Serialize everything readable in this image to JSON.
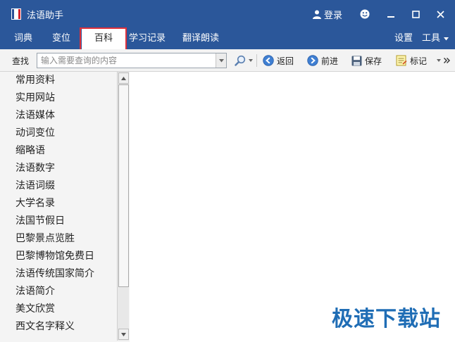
{
  "app": {
    "title": "法语助手"
  },
  "titlebar": {
    "login_label": "登录"
  },
  "menu": {
    "tabs": [
      {
        "label": "词典"
      },
      {
        "label": "变位"
      },
      {
        "label": "百科"
      },
      {
        "label": "学习记录"
      },
      {
        "label": "翻译朗读"
      }
    ],
    "active_tab": "百科",
    "settings_label": "设置",
    "tools_label": "工具"
  },
  "toolbar": {
    "search_label": "查找",
    "search_placeholder": "输入需要查询的内容",
    "search_value": "",
    "back_label": "返回",
    "forward_label": "前进",
    "save_label": "保存",
    "bookmark_label": "标记"
  },
  "sidebar": {
    "items": [
      "常用资料",
      "实用网站",
      "法语媒体",
      "动词变位",
      "缩略语",
      "法语数字",
      "法语词缀",
      "大学名录",
      "法国节假日",
      "巴黎景点览胜",
      "巴黎博物馆免费日",
      "法语传统国家简介",
      "法语简介",
      "美文欣赏",
      "西文名字释义"
    ]
  },
  "watermark": "极速下载站",
  "colors": {
    "titlebar": "#2b579a",
    "highlight": "#e0303a",
    "watermark": "#1f6db5"
  }
}
